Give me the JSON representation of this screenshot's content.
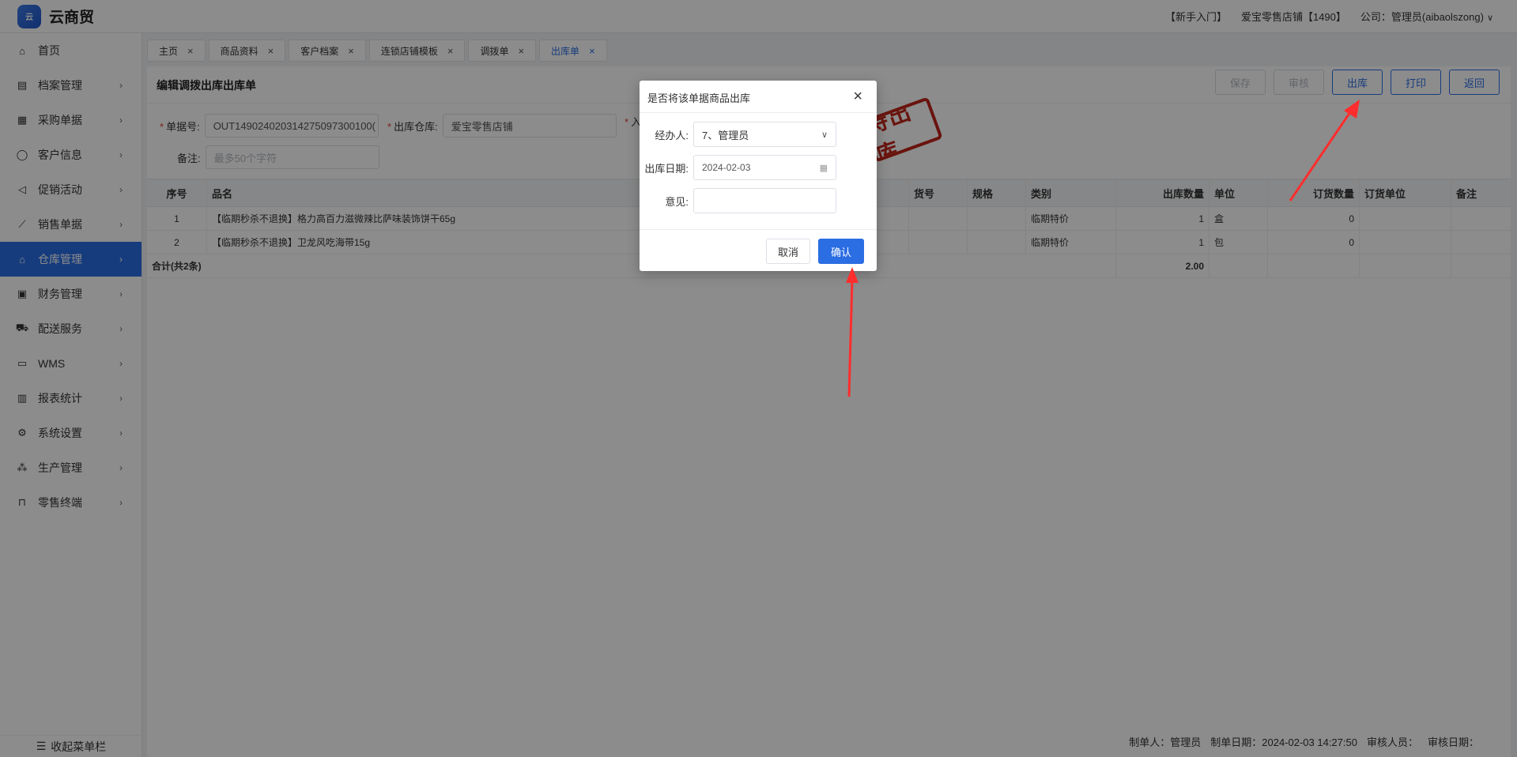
{
  "app": {
    "name": "云商贸",
    "logo_text": "云商贸"
  },
  "header": {
    "beginner": "【新手入门】",
    "store": "爱宝零售店铺【1490】",
    "company": "公司：管理员(aibaolszong)"
  },
  "sidebar": {
    "items": [
      {
        "label": "首页",
        "icon": "home-icon"
      },
      {
        "label": "档案管理",
        "icon": "archive-icon"
      },
      {
        "label": "采购单据",
        "icon": "purchase-doc-icon"
      },
      {
        "label": "客户信息",
        "icon": "user-icon"
      },
      {
        "label": "促销活动",
        "icon": "promo-icon"
      },
      {
        "label": "销售单据",
        "icon": "sales-chart-icon"
      },
      {
        "label": "仓库管理",
        "icon": "warehouse-icon"
      },
      {
        "label": "财务管理",
        "icon": "finance-icon"
      },
      {
        "label": "配送服务",
        "icon": "cart-icon"
      },
      {
        "label": "WMS",
        "icon": "truck-icon"
      },
      {
        "label": "报表统计",
        "icon": "report-icon"
      },
      {
        "label": "系统设置",
        "icon": "gear-icon"
      },
      {
        "label": "生产管理",
        "icon": "production-icon"
      },
      {
        "label": "零售终端",
        "icon": "retail-icon"
      }
    ],
    "active_index": 6,
    "collapse": "收起菜单栏"
  },
  "tabs": [
    "主页",
    "商品资料",
    "客户档案",
    "连锁店铺模板",
    "调拨单",
    "出库单"
  ],
  "page": {
    "title": "编辑调拨出库出库单",
    "toolbar": {
      "save": "保存",
      "audit": "审核",
      "outbound": "出库",
      "print": "打印",
      "back": "返回"
    },
    "form": {
      "doc_no_label": "单据号:",
      "doc_no": "OUT149024020314275097300100(",
      "warehouse_label": "出库仓库:",
      "warehouse": "爱宝零售店铺",
      "inbound_label_partial": "入",
      "remark_label": "备注:",
      "remark_placeholder": "最多50个字符"
    },
    "stamp": "待出库",
    "table": {
      "headers": [
        "序号",
        "品名",
        "货号",
        "规格",
        "类别",
        "出库数量",
        "单位",
        "订货数量",
        "订货单位",
        "备注"
      ],
      "rows": [
        {
          "no": "1",
          "name": "【临期秒杀不退换】格力高百力滋微辣比萨味装饰饼干65g",
          "code": "",
          "spec": "",
          "category": "临期特价",
          "qty": "1",
          "unit": "盒",
          "order_qty": "0",
          "order_unit": "",
          "remark": ""
        },
        {
          "no": "2",
          "name": "【临期秒杀不退换】卫龙风吃海带15g",
          "code": "",
          "spec": "",
          "category": "临期特价",
          "qty": "1",
          "unit": "包",
          "order_qty": "0",
          "order_unit": "",
          "remark": ""
        }
      ],
      "summary_label": "合计(共2条)",
      "summary_qty": "2.00"
    },
    "footer": {
      "maker": "制单人：管理员",
      "make_date": "制单日期：2024-02-03 14:27:50",
      "auditor": "审核人员：",
      "audit_date": "审核日期："
    }
  },
  "dialog": {
    "title": "是否将该单据商品出库",
    "handler_label": "经办人:",
    "handler_value": "7、管理员",
    "date_label": "出库日期:",
    "date_value": "2024-02-03",
    "opinion_label": "意见:",
    "opinion_value": "",
    "cancel": "取消",
    "confirm": "确认"
  },
  "colors": {
    "accent": "#2b6de3",
    "stamp": "#c0261b",
    "annotation_arrow": "#ff2d2d"
  }
}
